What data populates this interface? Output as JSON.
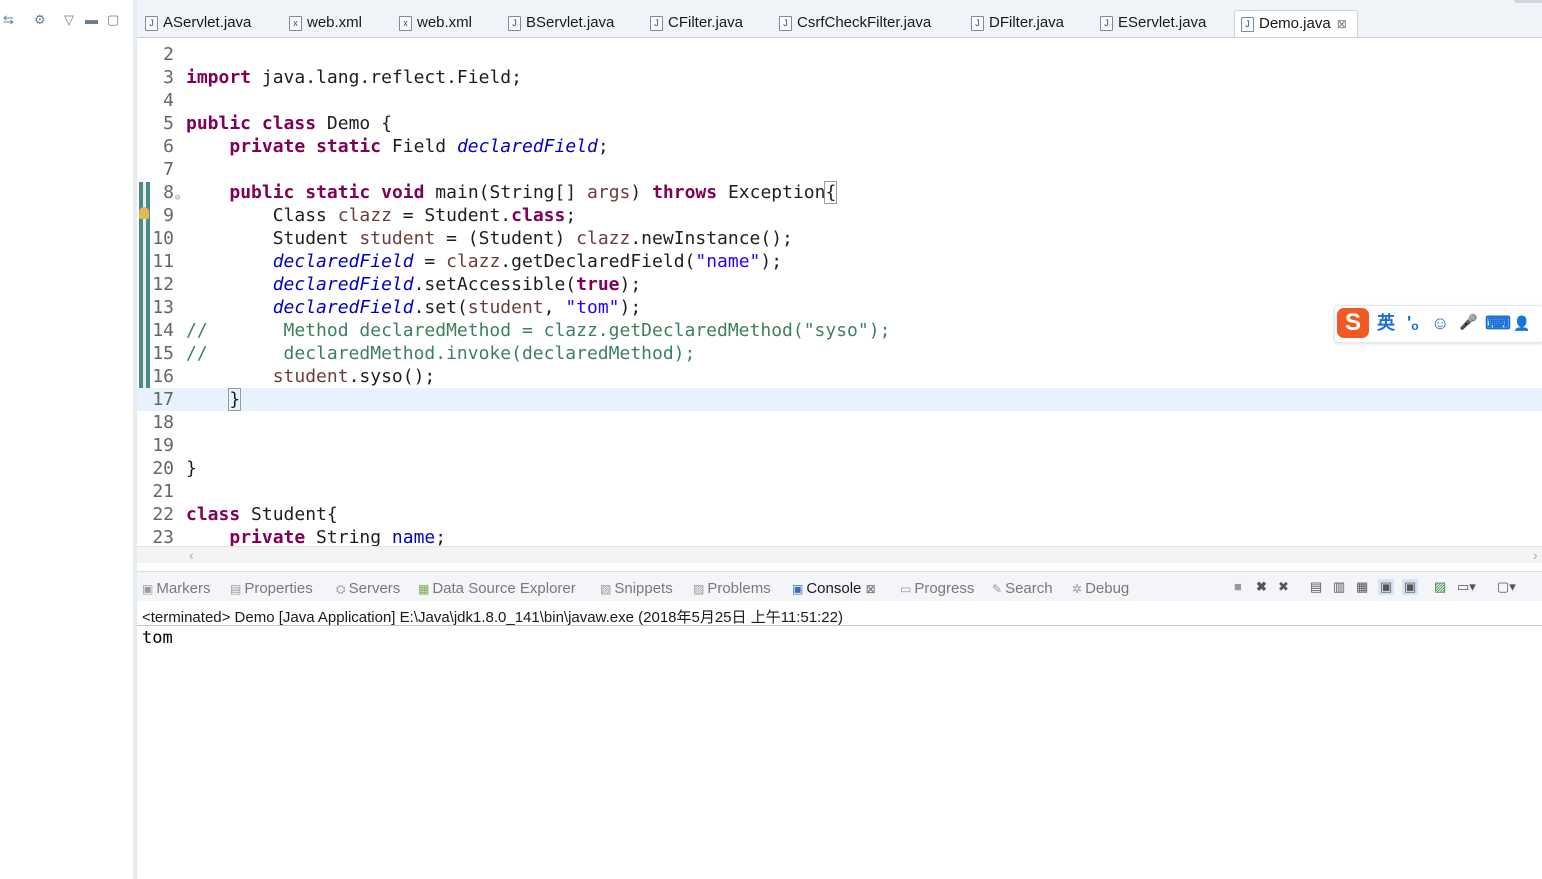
{
  "left_panel": {
    "icons": [
      "link-with-editor-icon",
      "collapse-all-icon",
      "view-menu-icon",
      "minimize-icon",
      "maximize-icon"
    ]
  },
  "tabs": [
    {
      "label": "AServlet.java",
      "icon": "J"
    },
    {
      "label": "web.xml",
      "icon": "x"
    },
    {
      "label": "web.xml",
      "icon": "x"
    },
    {
      "label": "BServlet.java",
      "icon": "J"
    },
    {
      "label": "CFilter.java",
      "icon": "J"
    },
    {
      "label": "CsrfCheckFilter.java",
      "icon": "J"
    },
    {
      "label": "DFilter.java",
      "icon": "J"
    },
    {
      "label": "EServlet.java",
      "icon": "J"
    },
    {
      "label": "Demo.java",
      "icon": "J",
      "active": true,
      "close": "⊠"
    }
  ],
  "editor": {
    "line_numbers": [
      "2",
      "3",
      "4",
      "5",
      "6",
      "7",
      "8",
      "9",
      "10",
      "11",
      "12",
      "13",
      "14",
      "15",
      "16",
      "17",
      "18",
      "19",
      "20",
      "21",
      "22",
      "23"
    ],
    "lines": {
      "l3": [
        "import",
        " java.lang.reflect.Field;"
      ],
      "l5": [
        "public",
        "class",
        " Demo {"
      ],
      "l6": [
        "private",
        "static",
        " Field ",
        "declaredField",
        ";"
      ],
      "l8": [
        "public",
        "static",
        "void",
        " main(String[] ",
        "args",
        ") ",
        "throws",
        " Exception",
        "{"
      ],
      "l9": [
        "Class ",
        "clazz",
        " = Student.",
        "class",
        ";"
      ],
      "l10": [
        "Student ",
        "student",
        " = (Student) ",
        "clazz",
        ".newInstance();"
      ],
      "l11": [
        "declaredField",
        " = ",
        "clazz",
        ".getDeclaredField(",
        "\"name\"",
        ");"
      ],
      "l12": [
        "declaredField",
        ".setAccessible(",
        "true",
        ");"
      ],
      "l13": [
        "declaredField",
        ".set(",
        "student",
        ", ",
        "\"tom\"",
        ");"
      ],
      "l14": "//       Method declaredMethod = clazz.getDeclaredMethod(\"syso\");",
      "l15": "//       declaredMethod.invoke(declaredMethod);",
      "l16": [
        "student",
        ".syso();"
      ],
      "l17": "}",
      "l20": "}",
      "l22": [
        "class",
        " Student{"
      ],
      "l23": [
        "private",
        " String ",
        "name",
        ";"
      ]
    }
  },
  "ime": {
    "logo": "S",
    "mode": "英",
    "items": [
      "'ₒ",
      "☺",
      "🎤",
      "⌨",
      "👤"
    ]
  },
  "views": {
    "tabs": [
      {
        "label": "Markers",
        "icon": "markers-icon",
        "glyph": "▣"
      },
      {
        "label": "Properties",
        "icon": "properties-icon",
        "glyph": "▤"
      },
      {
        "label": "Servers",
        "icon": "servers-icon",
        "glyph": "⛭"
      },
      {
        "label": "Data Source Explorer",
        "icon": "data-source-icon",
        "glyph": "▦"
      },
      {
        "label": "Snippets",
        "icon": "snippets-icon",
        "glyph": "▧"
      },
      {
        "label": "Problems",
        "icon": "problems-icon",
        "glyph": "▨"
      },
      {
        "label": "Console",
        "icon": "console-icon",
        "glyph": "▣",
        "active": true,
        "close": "⊠"
      },
      {
        "label": "Progress",
        "icon": "progress-icon",
        "glyph": "▭"
      },
      {
        "label": "Search",
        "icon": "search-icon",
        "glyph": "✎"
      },
      {
        "label": "Debug",
        "icon": "debug-icon",
        "glyph": "✲"
      }
    ],
    "toolbar_icons": [
      "terminate-icon",
      "remove-launch-icon",
      "remove-all-icon",
      "clear-console-icon",
      "scroll-lock-icon",
      "word-wrap-icon",
      "show-on-stdout-icon",
      "show-on-stderr-icon",
      "pin-console-icon",
      "display-console-icon",
      "open-console-icon",
      "view-menu-icon"
    ]
  },
  "console": {
    "header": "<terminated> Demo [Java Application] E:\\Java\\jdk1.8.0_141\\bin\\javaw.exe (2018年5月25日 上午11:51:22)",
    "output": "tom"
  }
}
